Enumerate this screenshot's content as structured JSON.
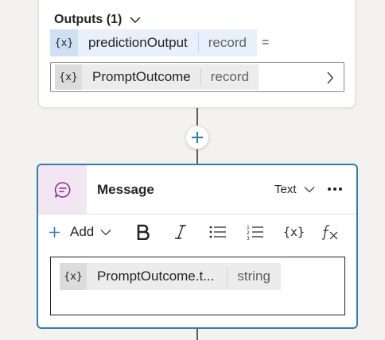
{
  "outputs": {
    "header_label": "Outputs (1)",
    "variable": {
      "icon": "variable-icon",
      "icon_text": "{x}",
      "name": "predictionOutput",
      "type": "record"
    },
    "equals": "=",
    "assigned": {
      "icon": "variable-icon",
      "icon_text": "{x}",
      "name": "PromptOutcome",
      "type": "record"
    }
  },
  "message": {
    "title": "Message",
    "type_label": "Text",
    "toolbar": {
      "add_label": "Add",
      "bold": "bold-icon",
      "italic": "italic-icon",
      "bullets": "bulleted-list-icon",
      "numbered": "numbered-list-icon",
      "variable_text": "{x}",
      "formula": "formula-icon"
    },
    "content_chip": {
      "icon_text": "{x}",
      "name": "PromptOutcome.t...",
      "type": "string"
    }
  },
  "colors": {
    "accent": "#2f7fa8",
    "message_icon_bg": "#f2e6f3",
    "message_icon": "#8a2a8a",
    "plus": "#2f7fa8"
  }
}
